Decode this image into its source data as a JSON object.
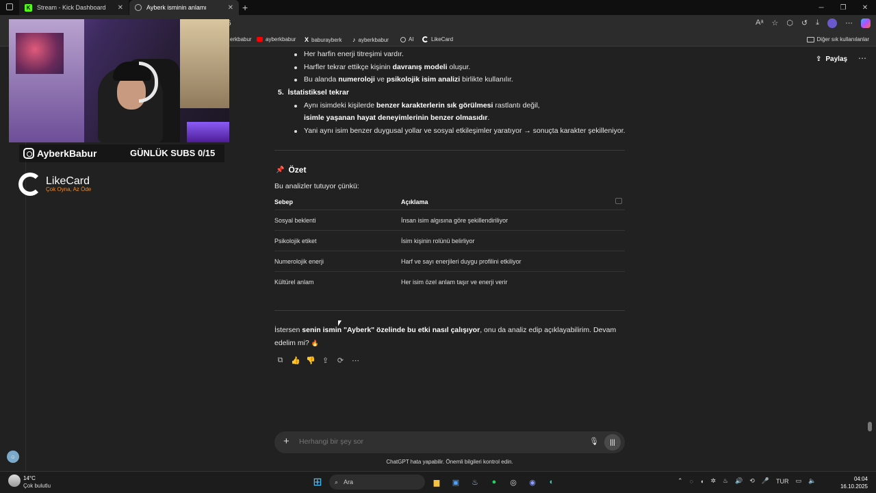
{
  "browser": {
    "tabs": [
      {
        "title": "Stream - Kick Dashboard"
      },
      {
        "title": "Ayberk isminin anlamı"
      }
    ],
    "address_partial": "5",
    "favorites": [
      {
        "label": "erkbabur"
      },
      {
        "label": "ayberkbabur"
      },
      {
        "label": "baburayberk"
      },
      {
        "label": "ayberkbabur"
      },
      {
        "label": "AI"
      },
      {
        "label": "LikeCard"
      }
    ],
    "other_favorites": "Diğer sık kullanılanlar"
  },
  "header": {
    "share_label": "Paylaş"
  },
  "content": {
    "bullets_top": [
      {
        "text": "Her harfin enerji titreşimi vardır."
      },
      {
        "pre": "Harfler tekrar ettikçe kişinin ",
        "bold": "davranış modeli",
        "post": " oluşur."
      },
      {
        "pre": "Bu alanda ",
        "bold": "numeroloji",
        "mid": " ve ",
        "bold2": "psikolojik isim analizi",
        "post": " birlikte kullanılır."
      }
    ],
    "section5": {
      "number": "5.",
      "title": "İstatistiksel tekrar",
      "b1_pre": "Aynı isimdeki kişilerde ",
      "b1_bold": "benzer karakterlerin sık görülmesi",
      "b1_post": " rastlantı değil,",
      "b1_line2": "isimle yaşanan hayat deneyimlerinin benzer olmasıdır",
      "b1_line2_end": ".",
      "b2": "Yani aynı isim benzer duygusal yollar ve sosyal etkileşimler yaratıyor → sonuçta karakter şekilleniyor."
    },
    "summary": {
      "emoji": "📌",
      "heading": "Özet",
      "intro": "Bu analizler tutuyor çünkü:",
      "table": {
        "headers": [
          "Sebep",
          "Açıklama"
        ],
        "rows": [
          [
            "Sosyal beklenti",
            "İnsan isim algısına göre şekillendiriliyor"
          ],
          [
            "Psikolojik etiket",
            "İsim kişinin rolünü belirliyor"
          ],
          [
            "Numerolojik enerji",
            "Harf ve sayı enerjileri duygu profilini etkiliyor"
          ],
          [
            "Kültürel anlam",
            "Her isim özel anlam taşır ve enerji verir"
          ]
        ]
      }
    },
    "final": {
      "pre": "İstersen ",
      "bold": "senin ismin \"Ayberk\" özelinde bu etki nasıl çalışıyor",
      "post": ", onu da analiz edip açıklayabilirim. Devam edelim mi? ",
      "emoji": "🔥"
    }
  },
  "composer": {
    "placeholder": "Herhangi bir şey sor",
    "disclaimer": "ChatGPT hata yapabilir. Önemli bilgileri kontrol edin."
  },
  "overlay": {
    "handle": "AyberkBabur",
    "subs": "GÜNLÜK SUBS 0/15",
    "sponsor_name": "LikeCard",
    "sponsor_tagline": "Çok Oyna, Az Öde"
  },
  "taskbar": {
    "temperature": "14°C",
    "condition": "Çok bulutlu",
    "search_label": "Ara",
    "language": "TUR",
    "time": "04:04",
    "date": "16.10.2025"
  }
}
